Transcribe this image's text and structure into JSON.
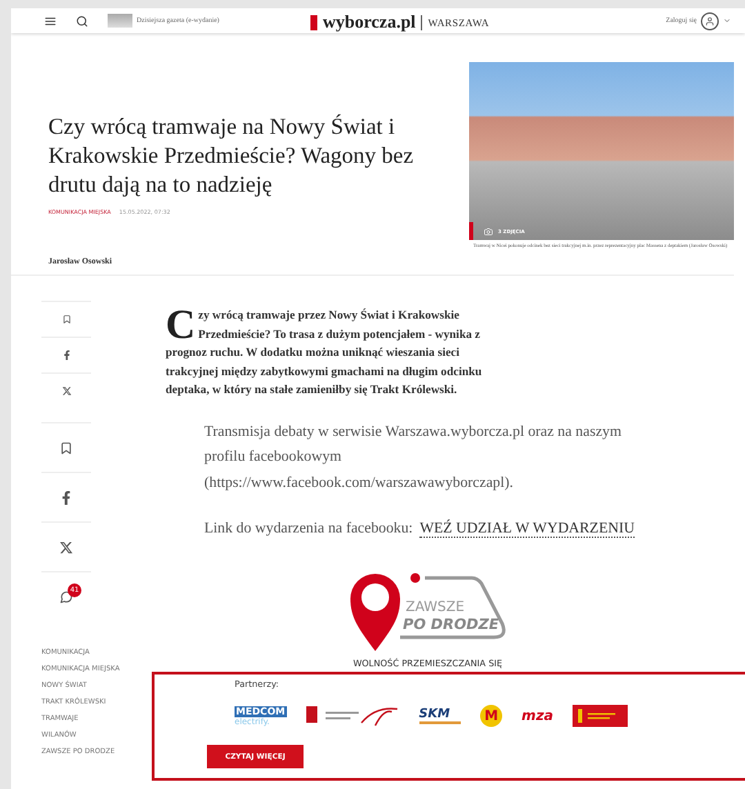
{
  "header": {
    "edition_link": "Dzisiejsza gazeta (e-wydanie)",
    "logo": "wyborcza.pl",
    "section": "WARSZAWA",
    "login": "Zaloguj się"
  },
  "article": {
    "title": "Czy wrócą tramwaje na Nowy Świat i Krakowskie Przedmieście? Wagony bez drutu dają na to nadzieję",
    "category": "KOMUNIKACJA MIEJSKA",
    "date": "15.05.2022, 07:32",
    "author": "Jarosław Osowski",
    "photo": {
      "count": "3 ZDJĘCIA",
      "caption": "Tramwaj w Nicei pokonuje odcinek bez sieci trakcyjnej m.in. przez reprezentacyjny plac Massena z deptakiem (Jarosław Osowski)"
    },
    "lede_initial": "C",
    "lede": "zy wrócą tramwaje przez Nowy Świat i Krakowskie Przedmieście? To trasa z dużym potencjałem - wynika z prognoz ruchu. W dodatku można uniknąć wieszania sieci trakcyjnej między zabytkowymi gmachami na długim odcinku deptaka, w który na stałe zamieniłby się Trakt Królewski.",
    "paragraph": "Transmisja debaty w serwisie Warszawa.wyborcza.pl oraz na naszym profilu facebookowym (https://www.facebook.com/warszawawyborczapl).",
    "link_intro": "Link do wydarzenia na facebooku:",
    "link": "WEŹ UDZIAŁ W WYDARZENIU"
  },
  "share_small": [
    {
      "kind": "bookmark"
    },
    {
      "kind": "facebook"
    },
    {
      "kind": "x"
    }
  ],
  "share_large": [
    {
      "kind": "bookmark"
    },
    {
      "kind": "facebook"
    },
    {
      "kind": "x"
    },
    {
      "kind": "comments",
      "count": "41"
    }
  ],
  "promo": {
    "logo_top": "ZAWSZE",
    "logo_bottom": "PO DRODZE",
    "tagline": "WOLNOŚĆ PRZEMIESZCZANIA SIĘ",
    "partners_label": "Partnerzy:",
    "partners": [
      {
        "kind": "medcom",
        "text": "MEDCOM",
        "subtext": "electrify."
      },
      {
        "kind": "city"
      },
      {
        "kind": "skm",
        "text": "SKM"
      },
      {
        "kind": "metro",
        "text": "M"
      },
      {
        "kind": "mza",
        "text": "mza"
      },
      {
        "kind": "tram"
      }
    ],
    "button": "CZYTAJ WIĘCEJ"
  },
  "tags": [
    "KOMUNIKACJA",
    "KOMUNIKACJA MIEJSKA",
    "NOWY ŚWIAT",
    "TRAKT KRÓLEWSKI",
    "TRAMWAJE",
    "WILANÓW",
    "ZAWSZE PO DRODZE"
  ]
}
